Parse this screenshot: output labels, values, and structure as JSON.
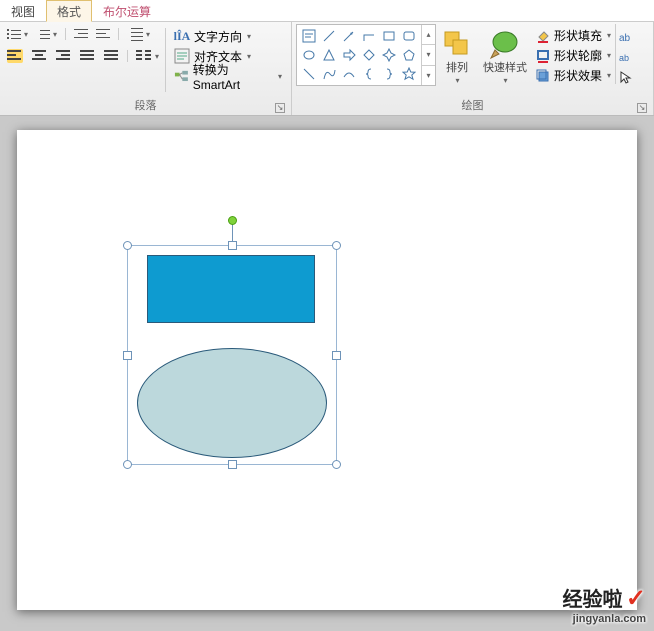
{
  "tabs": {
    "view": "视图",
    "format": "格式",
    "boolean": "布尔运算"
  },
  "ribbon": {
    "paragraph": {
      "title": "段落",
      "text_direction": "文字方向",
      "align_text": "对齐文本",
      "convert_smartart": "转换为 SmartArt"
    },
    "drawing": {
      "title": "绘图",
      "arrange": "排列",
      "quick_styles": "快速样式",
      "shape_fill": "形状填充",
      "shape_outline": "形状轮廓",
      "shape_effects": "形状效果"
    }
  },
  "watermark": {
    "brand": "经验啦",
    "url": "jingyanla.com"
  }
}
